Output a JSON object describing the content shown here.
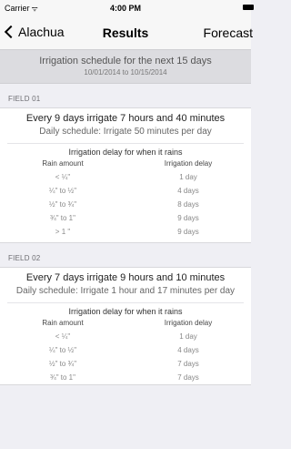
{
  "status": {
    "carrier": "Carrier",
    "wifi": "ᯤ",
    "time": "4:00 PM"
  },
  "nav": {
    "back": "Alachua",
    "title": "Results",
    "right": "Forecast"
  },
  "summary": {
    "title": "Irrigation schedule for the next 15 days",
    "dates": "10/01/2014 to 10/15/2014"
  },
  "fields": [
    {
      "header": "FIELD 01",
      "line1": "Every 9 days irrigate 7 hours and 40 minutes",
      "line2": "Daily schedule: Irrigate 50 minutes per day",
      "delay_title": "Irrigation delay for when it rains",
      "col1": "Rain amount",
      "col2": "Irrigation delay",
      "rows": [
        {
          "rain": "< ¼\"",
          "delay": "1 day"
        },
        {
          "rain": "¼\" to ½\"",
          "delay": "4 days"
        },
        {
          "rain": "½\" to ¾\"",
          "delay": "8 days"
        },
        {
          "rain": "¾\" to 1\"",
          "delay": "9 days"
        },
        {
          "rain": "> 1 \"",
          "delay": "9 days"
        }
      ]
    },
    {
      "header": "FIELD 02",
      "line1": "Every 7 days irrigate 9 hours and 10 minutes",
      "line2": "Daily schedule: Irrigate 1 hour and 17 minutes per day",
      "delay_title": "Irrigation delay for when it rains",
      "col1": "Rain amount",
      "col2": "Irrigation delay",
      "rows": [
        {
          "rain": "< ¼\"",
          "delay": "1 day"
        },
        {
          "rain": "¼\" to ½\"",
          "delay": "4 days"
        },
        {
          "rain": "½\" to ¾\"",
          "delay": "7 days"
        },
        {
          "rain": "¾\" to 1\"",
          "delay": "7 days"
        }
      ]
    }
  ]
}
